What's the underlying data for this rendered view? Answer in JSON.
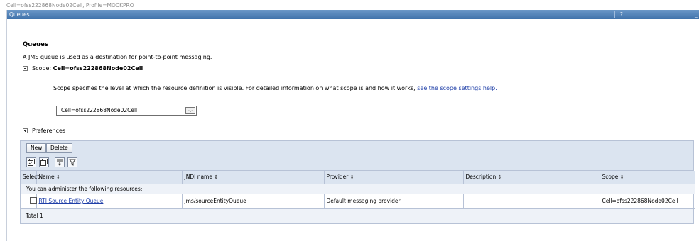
{
  "context": "Cell=ofss222868Node02Cell, Profile=MOCKPRO",
  "panel": {
    "title": "Queues",
    "help_label": "?",
    "minimize_label": "_"
  },
  "page": {
    "heading": "Queues",
    "description": "A JMS queue is used as a destination for point-to-point messaging."
  },
  "scope": {
    "label_prefix": "Scope: ",
    "label_value": "Cell=ofss222868Node02Cell",
    "help_text": "Scope specifies the level at which the resource definition is visible. For detailed information on what scope is and how it works, ",
    "help_link": "see the scope settings help.",
    "select_value": "Cell=ofss222868Node02Cell"
  },
  "preferences": {
    "label": "Preferences"
  },
  "toolbar": {
    "new_label": "New",
    "delete_label": "Delete"
  },
  "icons": [
    "select-all-icon",
    "deselect-all-icon",
    "show-filter-icon",
    "clear-filter-icon"
  ],
  "table": {
    "columns": [
      {
        "label": "Select",
        "sortable": false
      },
      {
        "label": "Name",
        "sortable": true
      },
      {
        "label": "JNDI name",
        "sortable": true
      },
      {
        "label": "Provider",
        "sortable": true
      },
      {
        "label": "Description",
        "sortable": true
      },
      {
        "label": "Scope",
        "sortable": true
      }
    ],
    "sort_glyph": "⇕",
    "group_label": "You can administer the following resources:",
    "rows": [
      {
        "name": "RTI Source Entity Queue",
        "jndi": "jms/sourceEntityQueue",
        "provider": "Default messaging provider",
        "description": "",
        "scope": "Cell=ofss222868Node02Cell"
      }
    ],
    "total": "Total 1"
  }
}
